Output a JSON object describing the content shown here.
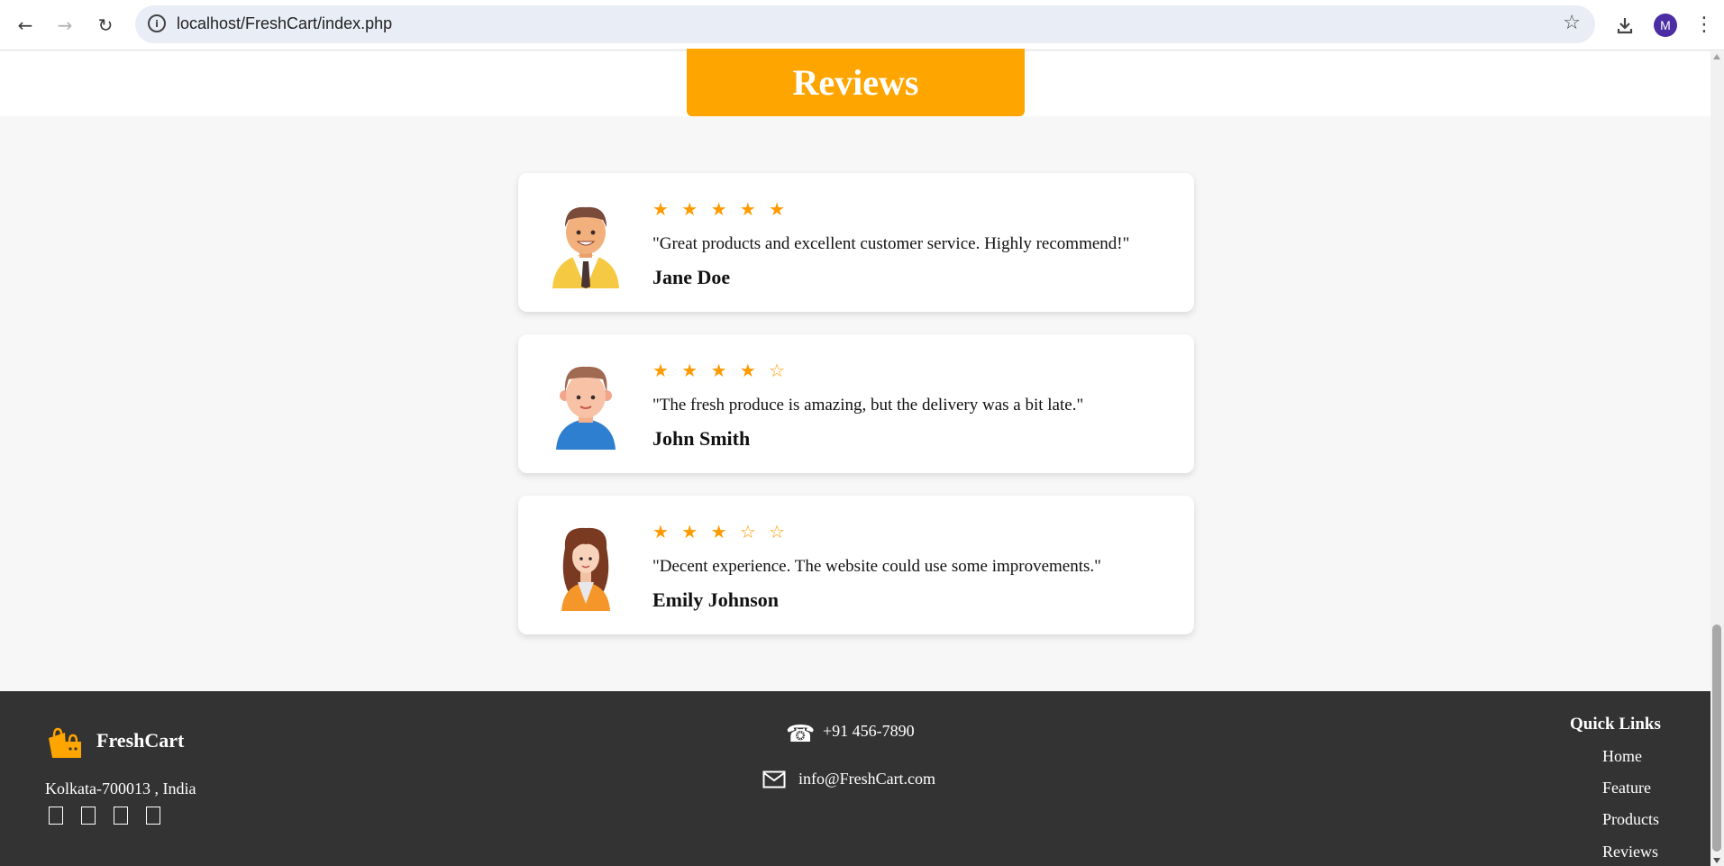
{
  "browser": {
    "url": "localhost/FreshCart/index.php",
    "profile_initial": "M"
  },
  "section": {
    "heading": "Reviews"
  },
  "reviews": [
    {
      "stars": "★ ★ ★ ★ ★",
      "rating": 5,
      "text": "\"Great products and excellent customer service. Highly recommend!\"",
      "name": "Jane Doe",
      "avatar_icon": "man-with-tie-avatar-icon"
    },
    {
      "stars": "★ ★ ★ ★ ☆",
      "rating": 4,
      "text": "\"The fresh produce is amazing, but the delivery was a bit late.\"",
      "name": "John Smith",
      "avatar_icon": "young-man-avatar-icon"
    },
    {
      "stars": "★ ★ ★ ☆ ☆",
      "rating": 3,
      "text": "\"Decent experience. The website could use some improvements.\"",
      "name": "Emily Johnson",
      "avatar_icon": "woman-avatar-icon"
    }
  ],
  "footer": {
    "brand": "FreshCart",
    "address": "Kolkata-700013 , India",
    "phone": "+91 456-7890",
    "email": "info@FreshCart.com",
    "quick_links_title": "Quick Links",
    "quick_links": [
      "Home",
      "Feature",
      "Products",
      "Reviews"
    ]
  },
  "colors": {
    "accent": "#ffa500",
    "star": "#ff9a00",
    "footer_bg": "#333333",
    "page_bg": "#f7f7f7"
  }
}
